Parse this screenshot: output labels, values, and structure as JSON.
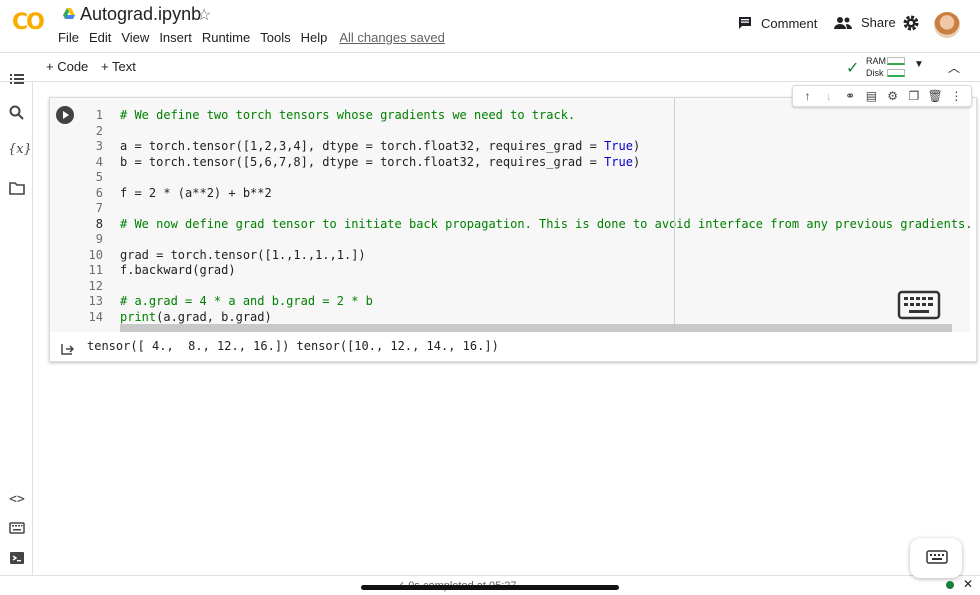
{
  "header": {
    "logo": "CO",
    "title": "Autograd.ipynb",
    "menu": [
      "File",
      "Edit",
      "View",
      "Insert",
      "Runtime",
      "Tools",
      "Help"
    ],
    "saved_status": "All changes saved",
    "comment_label": "Comment",
    "share_label": "Share"
  },
  "toolbar": {
    "add_code": "+ Code",
    "add_text": "+ Text",
    "ram_label": "RAM",
    "disk_label": "Disk"
  },
  "cell": {
    "lines": [
      {
        "n": "1",
        "text": "# We define two torch tensors whose gradients we need to track."
      },
      {
        "n": "2",
        "text": ""
      },
      {
        "n": "3",
        "text": "a = torch.tensor([1,2,3,4], dtype = torch.float32, requires_grad = True)"
      },
      {
        "n": "4",
        "text": "b = torch.tensor([5,6,7,8], dtype = torch.float32, requires_grad = True)"
      },
      {
        "n": "5",
        "text": ""
      },
      {
        "n": "6",
        "text": "f = 2 * (a**2) + b**2"
      },
      {
        "n": "7",
        "text": ""
      },
      {
        "n": "8",
        "text": "# We now define grad tensor to initiate back propagation. This is done to avoid interface from any previous gradients."
      },
      {
        "n": "9",
        "text": ""
      },
      {
        "n": "10",
        "text": "grad = torch.tensor([1.,1.,1.,1.])"
      },
      {
        "n": "11",
        "text": "f.backward(grad)"
      },
      {
        "n": "12",
        "text": ""
      },
      {
        "n": "13",
        "text": "# a.grad = 4 * a and b.grad = 2 * b"
      },
      {
        "n": "14",
        "text": "print(a.grad, b.grad)"
      }
    ],
    "output": "tensor([ 4.,  8., 12., 16.]) tensor([10., 12., 14., 16.])"
  },
  "status": {
    "text": "✓ 0s    completed at 05:27"
  },
  "colors": {
    "comment": "#008000",
    "keyword": "#0000cc",
    "accent_check": "#188038"
  }
}
